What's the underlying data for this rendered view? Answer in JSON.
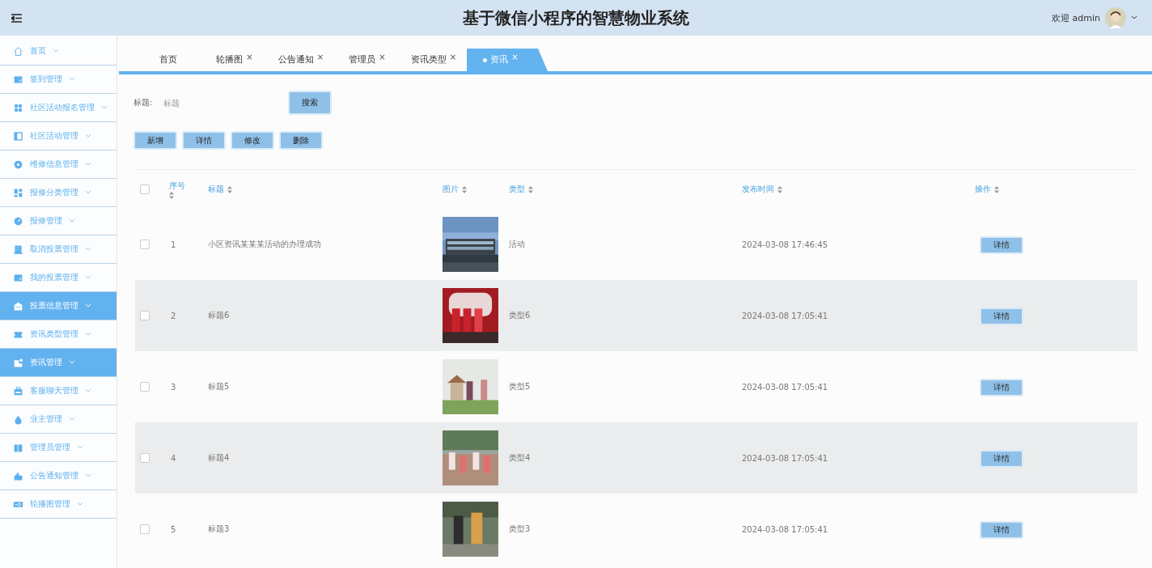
{
  "header": {
    "title": "基于微信小程序的智慧物业系统",
    "welcome": "欢迎 admin"
  },
  "sidebar": {
    "items": [
      {
        "label": "首页",
        "selected": false
      },
      {
        "label": "签到管理",
        "selected": false
      },
      {
        "label": "社区活动报名管理",
        "selected": false
      },
      {
        "label": "社区活动管理",
        "selected": false
      },
      {
        "label": "维修信息管理",
        "selected": false
      },
      {
        "label": "报修分类管理",
        "selected": false
      },
      {
        "label": "报修管理",
        "selected": false
      },
      {
        "label": "取消投票管理",
        "selected": false
      },
      {
        "label": "我的投票管理",
        "selected": false
      },
      {
        "label": "投票信息管理",
        "selected": true
      },
      {
        "label": "资讯类型管理",
        "selected": false
      },
      {
        "label": "资讯管理",
        "selected": true
      },
      {
        "label": "客服聊天管理",
        "selected": false
      },
      {
        "label": "业主管理",
        "selected": false
      },
      {
        "label": "管理员管理",
        "selected": false
      },
      {
        "label": "公告通知管理",
        "selected": false
      },
      {
        "label": "轮播图管理",
        "selected": false
      }
    ]
  },
  "tabs": [
    {
      "label": "首页",
      "closable": false,
      "selected": false
    },
    {
      "label": "轮播图",
      "closable": true,
      "selected": false
    },
    {
      "label": "公告通知",
      "closable": true,
      "selected": false
    },
    {
      "label": "管理员",
      "closable": true,
      "selected": false
    },
    {
      "label": "资讯类型",
      "closable": true,
      "selected": false
    },
    {
      "label": "资讯",
      "closable": true,
      "selected": true
    }
  ],
  "close_mark": "×",
  "search": {
    "label": "标题:",
    "placeholder": "标题",
    "button": "搜索"
  },
  "actions": [
    "新增",
    "详情",
    "修改",
    "删除"
  ],
  "table": {
    "all_checked": false,
    "columns": [
      "序号",
      "标题",
      "图片",
      "类型",
      "发布时间",
      "操作"
    ],
    "rows": [
      {
        "checked": false,
        "index": "1",
        "title": "小区资讯某某某活动的办理成功",
        "type": "活动",
        "time": "2024-03-08 17:46:45",
        "action": "详情"
      },
      {
        "checked": false,
        "index": "2",
        "title": "标题6",
        "type": "类型6",
        "time": "2024-03-08 17:05:41",
        "action": "详情"
      },
      {
        "checked": false,
        "index": "3",
        "title": "标题5",
        "type": "类型5",
        "time": "2024-03-08 17:05:41",
        "action": "详情"
      },
      {
        "checked": false,
        "index": "4",
        "title": "标题4",
        "type": "类型4",
        "time": "2024-03-08 17:05:41",
        "action": "详情"
      },
      {
        "checked": false,
        "index": "5",
        "title": "标题3",
        "type": "类型3",
        "time": "2024-03-08 17:05:41",
        "action": "详情"
      }
    ]
  }
}
